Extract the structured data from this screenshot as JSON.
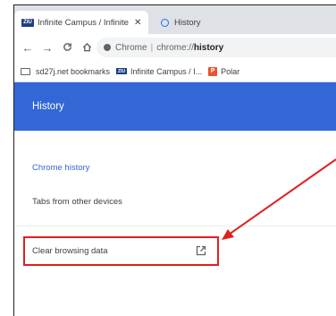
{
  "browser": {
    "tabs": [
      {
        "title": "Infinite Campus / Infinite Campus",
        "favicon_text": "ZIU",
        "close": "✕"
      },
      {
        "title": "History"
      }
    ],
    "omnibox": {
      "site": "Chrome",
      "url_prefix": "chrome://",
      "url_bold": "history"
    },
    "bookmarks": [
      {
        "label": "sd27j.net bookmarks"
      },
      {
        "label": "Infinite Campus / I...",
        "icon_text": "ZIU"
      },
      {
        "label": "Polar",
        "icon_text": "P"
      }
    ]
  },
  "page": {
    "title": "History",
    "sidebar": {
      "items": [
        {
          "label": "Chrome history"
        },
        {
          "label": "Tabs from other devices"
        }
      ],
      "clear_browsing": {
        "label": "Clear browsing data"
      }
    }
  },
  "annotation": {
    "color": "#e02020"
  },
  "colors": {
    "header": "#3367d6",
    "accent": "#3367d6"
  }
}
